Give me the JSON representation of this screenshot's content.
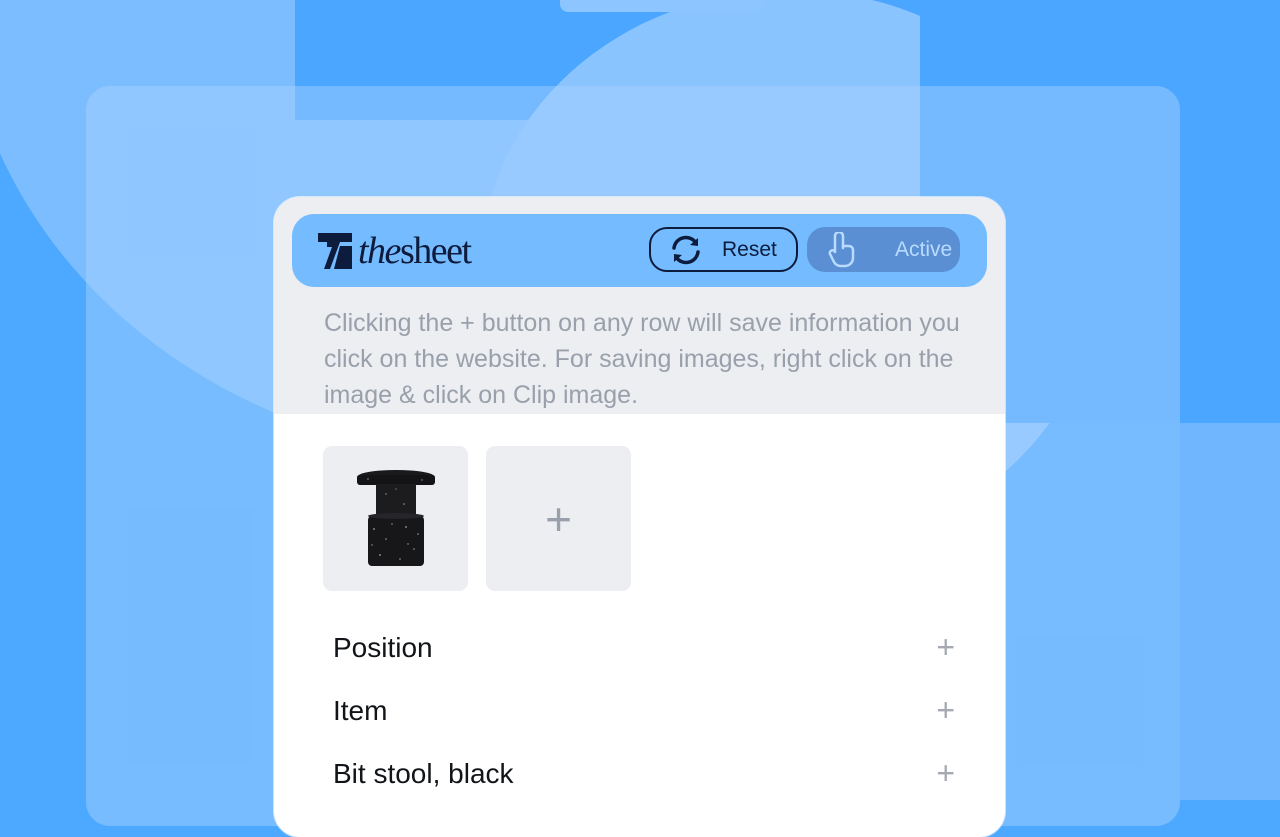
{
  "header": {
    "logo_text_the": "the",
    "logo_text_sheet": "sheet",
    "reset_label": "Reset",
    "active_label": "Active"
  },
  "hint": "Clicking the + button on any row will save information you click on the website. For saving images, right click on the image & click on Clip image.",
  "images": {
    "add_label": "+"
  },
  "rows": [
    {
      "label": "Position",
      "add": "+"
    },
    {
      "label": "Item",
      "add": "+"
    },
    {
      "label": "Bit stool, black",
      "add": "+"
    }
  ],
  "icons": [
    "refresh-icon",
    "hand-pointer-icon",
    "plus-icon",
    "logo-mark-icon"
  ],
  "colors": {
    "background": "#4da9ff",
    "header_bar": "#74bcff",
    "active_button": "#5a8fd3",
    "text_dark": "#0d1b3d",
    "hint_text": "#9aa0ab"
  }
}
